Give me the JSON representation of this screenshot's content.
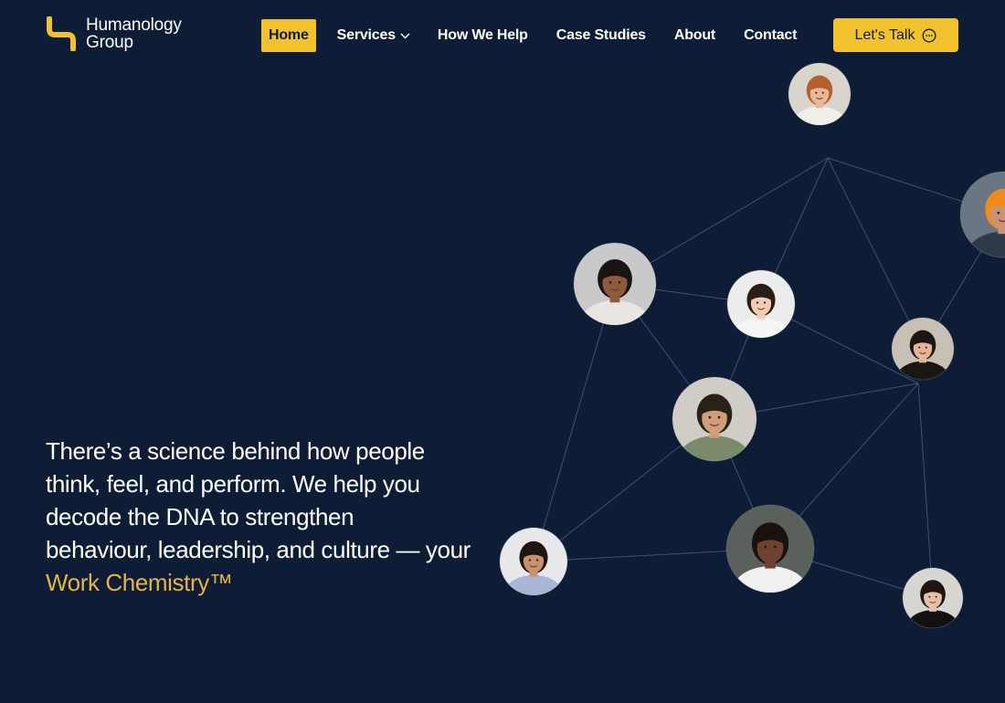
{
  "brand": {
    "line1": "Humanology",
    "line2": "Group",
    "accent_color": "#f2c12e",
    "background_color": "#0f1c36"
  },
  "nav": {
    "home": "Home",
    "services": "Services",
    "how_we_help": "How We Help",
    "case_studies": "Case Studies",
    "about": "About",
    "contact": "Contact"
  },
  "cta": {
    "label": "Let's Talk",
    "icon": "chat-bubble-icon"
  },
  "hero": {
    "line1": "There’s a science behind how people",
    "line2": "think, feel, and perform. We help you",
    "line3": "decode the DNA to strengthen",
    "line4": "behaviour, leadership, and culture — your",
    "highlight": "Work Chemistry™"
  },
  "network": {
    "people": [
      {
        "id": "woman-glasses-top",
        "skin": "#e8b898",
        "hair": "#b5612e",
        "top": "#f1efe9",
        "bg": "#d9d4cc"
      },
      {
        "id": "worker-hardhat",
        "skin": "#c99474",
        "hair": "#f08a1c",
        "top": "#2f3a48",
        "bg": "#6a7684"
      },
      {
        "id": "woman-curly-hair",
        "skin": "#8e5a3e",
        "hair": "#1b1412",
        "top": "#e9e6e1",
        "bg": "#c9c9c9"
      },
      {
        "id": "woman-laptop",
        "skin": "#f0cdb4",
        "hair": "#2a1c16",
        "top": "#f5f5f5",
        "bg": "#ececec"
      },
      {
        "id": "woman-hijab",
        "skin": "#e1b596",
        "hair": "#1a1614",
        "top": "#1a1614",
        "bg": "#c8c0b4"
      },
      {
        "id": "man-glasses-center",
        "skin": "#cf9f7b",
        "hair": "#2a2018",
        "top": "#7a8a6a",
        "bg": "#cfcdc6"
      },
      {
        "id": "woman-smiling-left",
        "skin": "#c89272",
        "hair": "#20160f",
        "top": "#a9b6d6",
        "bg": "#e8e8ea"
      },
      {
        "id": "woman-striped-top",
        "skin": "#6e4130",
        "hair": "#1a120c",
        "top": "#f0f0f2",
        "bg": "#5a605c"
      },
      {
        "id": "woman-dark-hair",
        "skin": "#e6c0a4",
        "hair": "#1f1613",
        "top": "#141010",
        "bg": "#d8d6d0"
      }
    ]
  }
}
